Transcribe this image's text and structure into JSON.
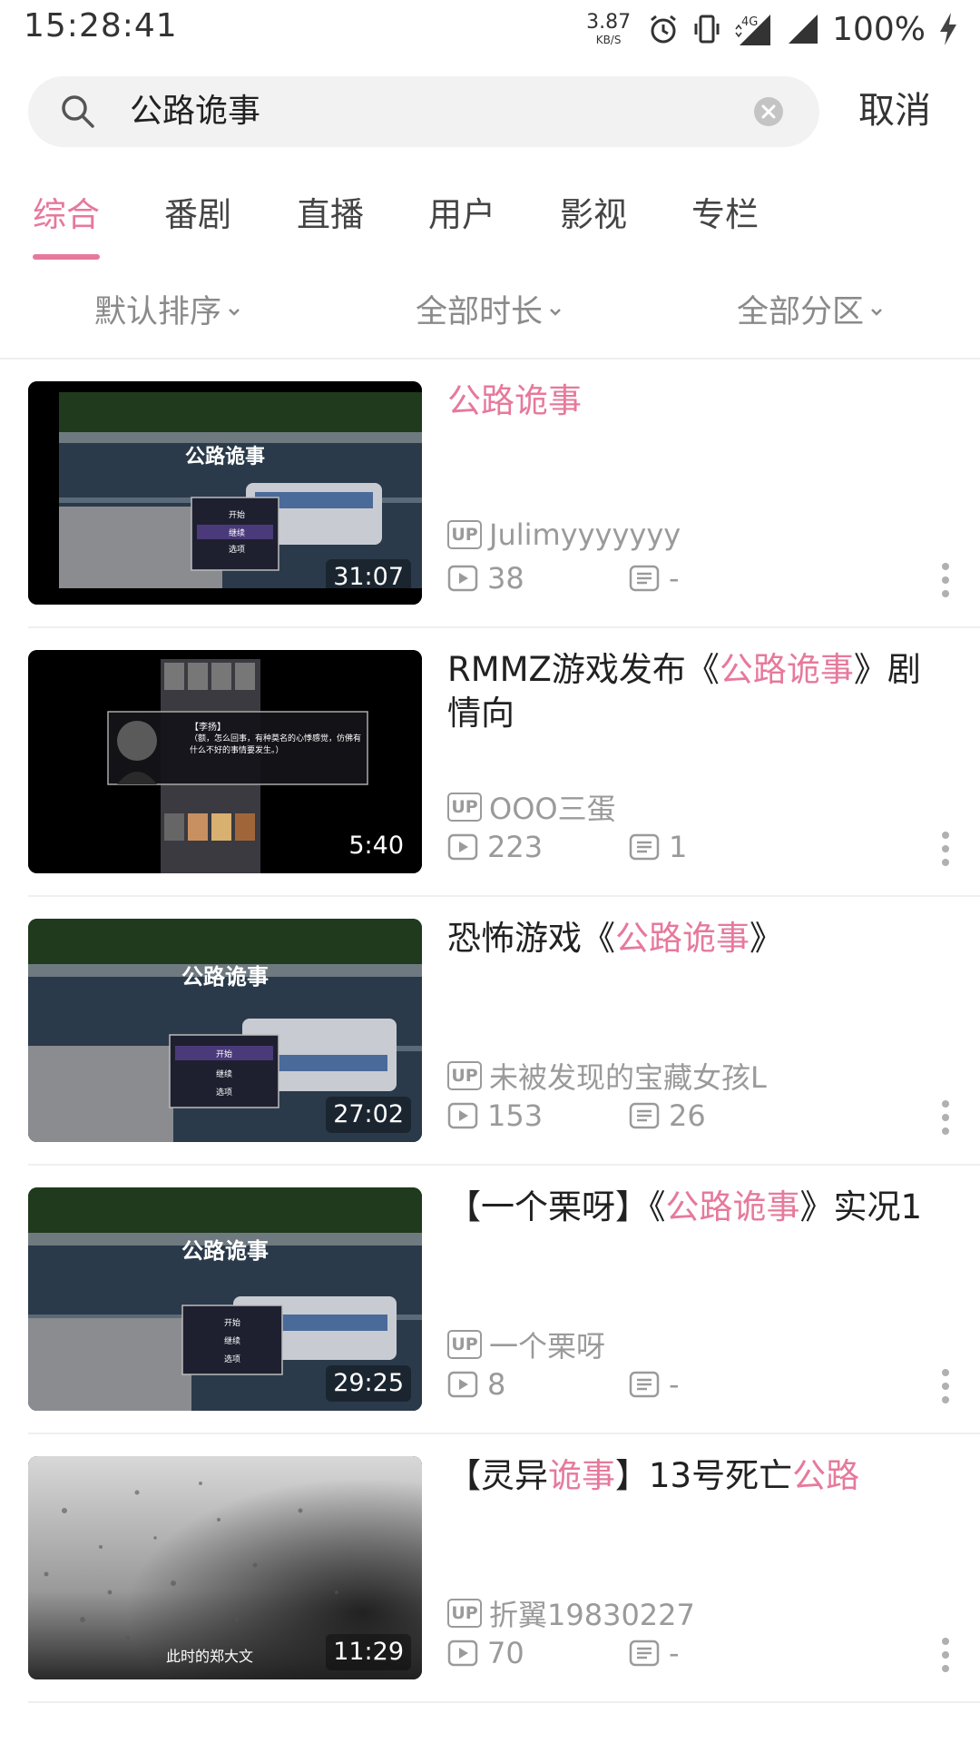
{
  "status_bar": {
    "time": "15:28:41",
    "net_speed": "3.87",
    "net_unit": "KB/S",
    "network_type": "4G",
    "battery": "100%"
  },
  "search": {
    "query": "公路诡事",
    "cancel_label": "取消"
  },
  "tabs": [
    "综合",
    "番剧",
    "直播",
    "用户",
    "影视",
    "专栏"
  ],
  "active_tab": "综合",
  "filters": [
    "默认排序",
    "全部时长",
    "全部分区"
  ],
  "accent_color": "#e6799c",
  "videos": [
    {
      "title_parts": [
        {
          "t": "公路诡事",
          "hl": true
        }
      ],
      "title_line2": "",
      "duration": "31:07",
      "uploader": "Julimyyyyyyy",
      "plays": "38",
      "danmaku": "-",
      "thumb_menu": [
        "开始",
        "继续",
        "选项"
      ],
      "thumb_title": "公路诡事"
    },
    {
      "title_parts": [
        {
          "t": "RMMZ游戏发布《",
          "hl": false
        },
        {
          "t": "公路诡事",
          "hl": true
        },
        {
          "t": "》剧",
          "hl": false
        }
      ],
      "title_line2": "情向",
      "duration": "5:40",
      "uploader": "OOO三蛋",
      "plays": "223",
      "danmaku": "1",
      "thumb_dialog_name": "【李扬】",
      "thumb_dialog_text": "（额，怎么回事，有种莫名的心悸感觉，仿佛有什么不好的事情要发生。）"
    },
    {
      "title_parts": [
        {
          "t": "恐怖游戏《",
          "hl": false
        },
        {
          "t": "公路诡事",
          "hl": true
        },
        {
          "t": "》",
          "hl": false
        }
      ],
      "title_line2": "",
      "duration": "27:02",
      "uploader": "未被发现的宝藏女孩L",
      "plays": "153",
      "danmaku": "26",
      "thumb_menu": [
        "开始",
        "继续",
        "选项"
      ],
      "thumb_title": "公路诡事"
    },
    {
      "title_parts": [
        {
          "t": "【一个栗呀】《",
          "hl": false
        },
        {
          "t": "公路诡事",
          "hl": true
        },
        {
          "t": "》实况1",
          "hl": false
        }
      ],
      "title_line2": "",
      "duration": "29:25",
      "uploader": "一个栗呀",
      "plays": "8",
      "danmaku": "-",
      "thumb_menu": [
        "开始",
        "继续",
        "选项"
      ],
      "thumb_title": "公路诡事"
    },
    {
      "title_parts": [
        {
          "t": "【灵异",
          "hl": false
        },
        {
          "t": "诡事",
          "hl": true
        },
        {
          "t": "】13号死亡",
          "hl": false
        },
        {
          "t": "公路",
          "hl": true
        }
      ],
      "title_line2": "",
      "duration": "11:29",
      "uploader": "折翼19830227",
      "plays": "70",
      "danmaku": "-",
      "thumb_caption": "此时的郑大文"
    }
  ]
}
